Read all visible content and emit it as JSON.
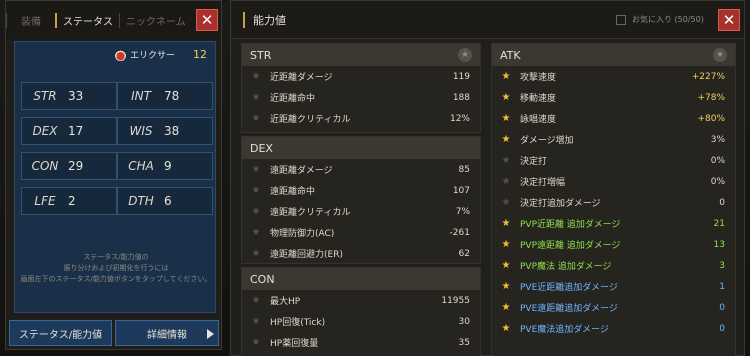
{
  "left_panel": {
    "tabs": [
      "装備",
      "ステータス",
      "ニックネーム"
    ],
    "elixir": {
      "label": "エリクサー",
      "value": "12"
    },
    "stats": [
      {
        "name": "STR",
        "value": "33"
      },
      {
        "name": "INT",
        "value": "78"
      },
      {
        "name": "DEX",
        "value": "17"
      },
      {
        "name": "WIS",
        "value": "38"
      },
      {
        "name": "CON",
        "value": "29"
      },
      {
        "name": "CHA",
        "value": "9"
      },
      {
        "name": "LFE",
        "value": "2"
      },
      {
        "name": "DTH",
        "value": "6"
      }
    ],
    "hint": [
      "ステータス/能力値の",
      "振り分けおよび初期化を行うには",
      "画面左下のステータス/能力値ボタンをタップしてください。"
    ],
    "buttons": {
      "status": "ステータス/能力値",
      "details": "詳細情報"
    }
  },
  "right_panel": {
    "title": "能力値",
    "favorites": "お気に入り (50/50)",
    "sections": {
      "str": {
        "title": "STR",
        "rows": [
          {
            "label": "近距離ダメージ",
            "value": "119"
          },
          {
            "label": "近距離命中",
            "value": "188"
          },
          {
            "label": "近距離クリティカル",
            "value": "12%"
          }
        ]
      },
      "dex": {
        "title": "DEX",
        "rows": [
          {
            "label": "遠距離ダメージ",
            "value": "85"
          },
          {
            "label": "遠距離命中",
            "value": "107"
          },
          {
            "label": "遠距離クリティカル",
            "value": "7%"
          },
          {
            "label": "物理防御力(AC)",
            "value": "-261"
          },
          {
            "label": "遠距離回避力(ER)",
            "value": "62"
          }
        ]
      },
      "con": {
        "title": "CON",
        "rows": [
          {
            "label": "最大HP",
            "value": "11955"
          },
          {
            "label": "HP回復(Tick)",
            "value": "30"
          },
          {
            "label": "HP薬回復量",
            "value": "35"
          }
        ]
      },
      "atk": {
        "title": "ATK",
        "rows": [
          {
            "label": "攻撃速度",
            "value": "+227%",
            "star": true,
            "color": "yellow"
          },
          {
            "label": "移動速度",
            "value": "+78%",
            "star": true,
            "color": "yellow"
          },
          {
            "label": "詠唱速度",
            "value": "+80%",
            "star": true,
            "color": "yellow"
          },
          {
            "label": "ダメージ増加",
            "value": "3%",
            "star": true,
            "color": "white"
          },
          {
            "label": "決定打",
            "value": "0%",
            "star": false,
            "color": "white"
          },
          {
            "label": "決定打増幅",
            "value": "0%",
            "star": false,
            "color": "white"
          },
          {
            "label": "決定打追加ダメージ",
            "value": "0",
            "star": false,
            "color": "white"
          },
          {
            "label": "PVP近距離 追加ダメージ",
            "value": "21",
            "star": true,
            "color": "green"
          },
          {
            "label": "PVP遠距離 追加ダメージ",
            "value": "13",
            "star": true,
            "color": "green"
          },
          {
            "label": "PVP魔法 追加ダメージ",
            "value": "3",
            "star": true,
            "color": "green"
          },
          {
            "label": "PVE近距離追加ダメージ",
            "value": "1",
            "star": true,
            "color": "blue"
          },
          {
            "label": "PVE遠距離追加ダメージ",
            "value": "0",
            "star": true,
            "color": "blue"
          },
          {
            "label": "PVE魔法追加ダメージ",
            "value": "0",
            "star": true,
            "color": "blue"
          }
        ]
      }
    }
  },
  "colors": {
    "accent_gold": "#c8a04a",
    "close_red": "#a8322b",
    "panel_blue": "#1a3048",
    "pvp_green": "#8fe04a",
    "pve_blue": "#6db5ff",
    "star_gold": "#f0c030"
  },
  "icons": {
    "close": "close-icon",
    "elixir": "elixir-flask-icon",
    "star": "star-icon",
    "arrow": "arrow-right-icon"
  }
}
